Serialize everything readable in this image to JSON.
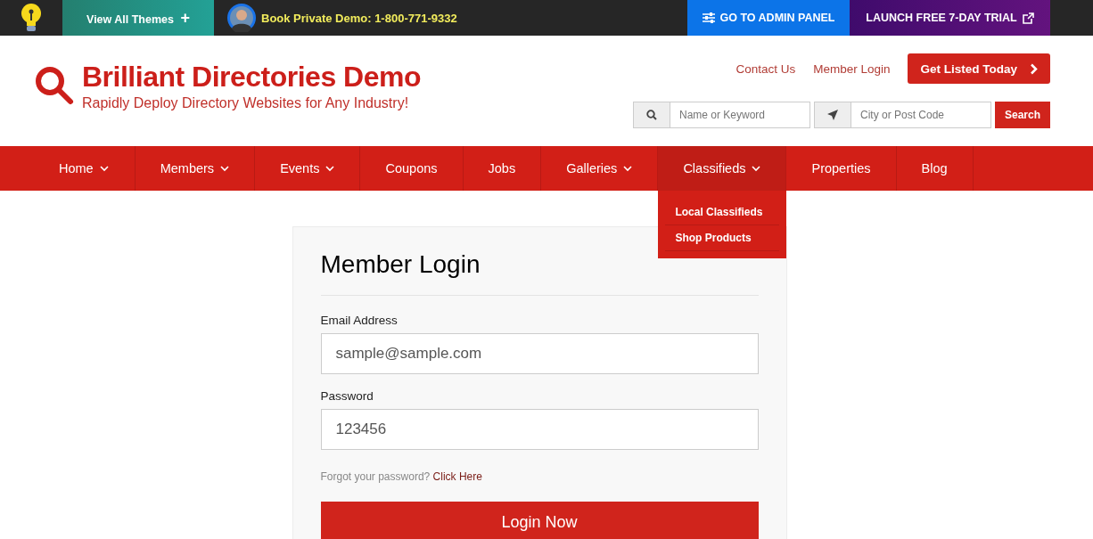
{
  "top_bar": {
    "themes_button": "View All Themes",
    "plus": "+",
    "demo_text": "Book Private Demo: 1-800-771-9332",
    "admin_button": "GO TO ADMIN PANEL",
    "trial_button": "LAUNCH FREE 7-DAY TRIAL"
  },
  "header": {
    "site_title": "Brilliant Directories Demo",
    "tagline": "Rapidly Deploy Directory Websites for Any Industry!",
    "links": [
      "Contact Us",
      "Member Login"
    ],
    "cta": "Get Listed Today",
    "keyword_placeholder": "Name or Keyword",
    "location_placeholder": "City or Post Code",
    "search_button": "Search"
  },
  "nav": [
    {
      "label": "Home",
      "dropdown": true,
      "selected": false
    },
    {
      "label": "Members",
      "dropdown": true,
      "selected": false
    },
    {
      "label": "Events",
      "dropdown": true,
      "selected": false
    },
    {
      "label": "Coupons",
      "dropdown": false,
      "selected": false
    },
    {
      "label": "Jobs",
      "dropdown": false,
      "selected": false
    },
    {
      "label": "Galleries",
      "dropdown": true,
      "selected": false
    },
    {
      "label": "Classifieds",
      "dropdown": true,
      "selected": true,
      "expanded": true,
      "children": [
        "Local Classifieds",
        "Shop Products"
      ]
    },
    {
      "label": "Properties",
      "dropdown": false,
      "selected": false
    },
    {
      "label": "Blog",
      "dropdown": false,
      "selected": false
    }
  ],
  "login": {
    "title": "Member Login",
    "email_label": "Email Address",
    "email_value": "sample@sample.com",
    "password_label": "Password",
    "password_value": "123456",
    "forgot_text": "Forgot your password?",
    "forgot_link": "Click Here",
    "submit": "Login Now"
  }
}
